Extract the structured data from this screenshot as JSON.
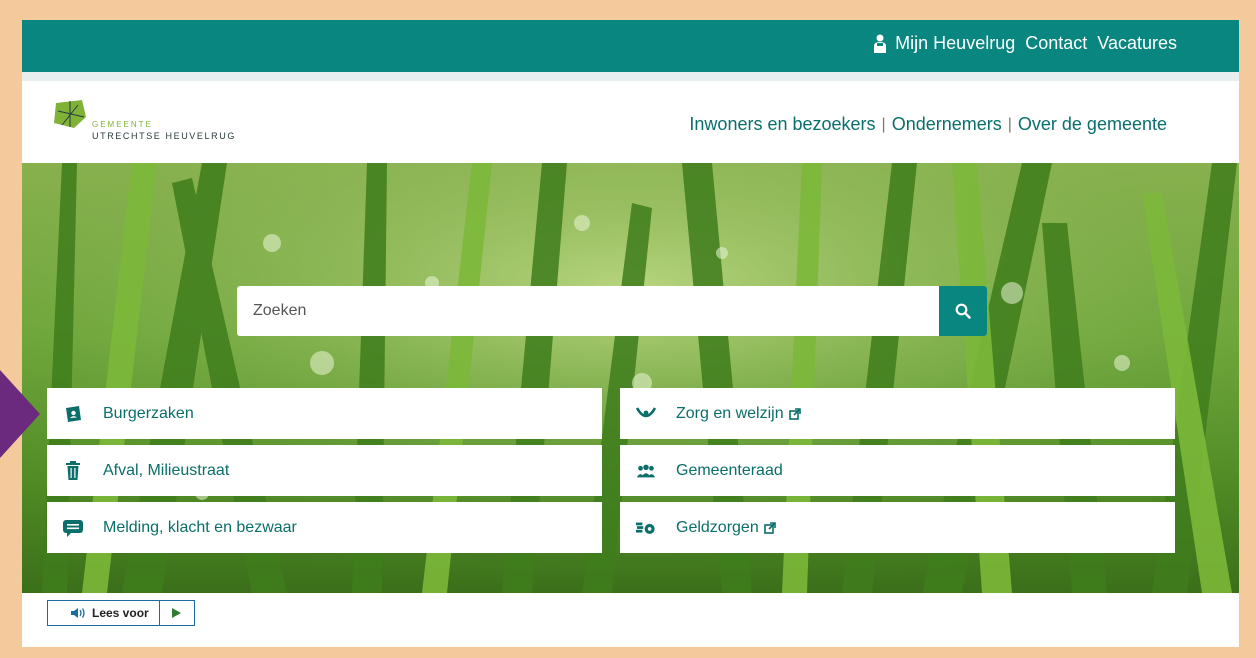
{
  "topbar": {
    "links": [
      "Mijn Heuvelrug",
      "Contact",
      "Vacatures"
    ]
  },
  "logo": {
    "small": "GEMEENTE",
    "big": "UTRECHTSE HEUVELRUG"
  },
  "mainnav": {
    "items": [
      "Inwoners en bezoekers",
      "Ondernemers",
      "Over de gemeente"
    ]
  },
  "search": {
    "placeholder": "Zoeken",
    "button_icon": "search-icon"
  },
  "tiles": {
    "left": [
      {
        "label": "Burgerzaken",
        "icon": "id-card-icon"
      },
      {
        "label": "Afval, Milieustraat",
        "icon": "trash-icon"
      },
      {
        "label": "Melding, klacht en bezwaar",
        "icon": "chat-icon"
      }
    ],
    "right": [
      {
        "label": "Zorg en welzijn",
        "icon": "care-icon",
        "external": true
      },
      {
        "label": "Gemeenteraad",
        "icon": "people-icon",
        "external": false
      },
      {
        "label": "Geldzorgen",
        "icon": "money-icon",
        "external": true
      }
    ]
  },
  "readbar": {
    "label": "Lees voor"
  },
  "colors": {
    "teal": "#0a8680",
    "link": "#0a6e6a",
    "frame": "#f4c99b",
    "accent_arrow": "#6b2a7e"
  }
}
